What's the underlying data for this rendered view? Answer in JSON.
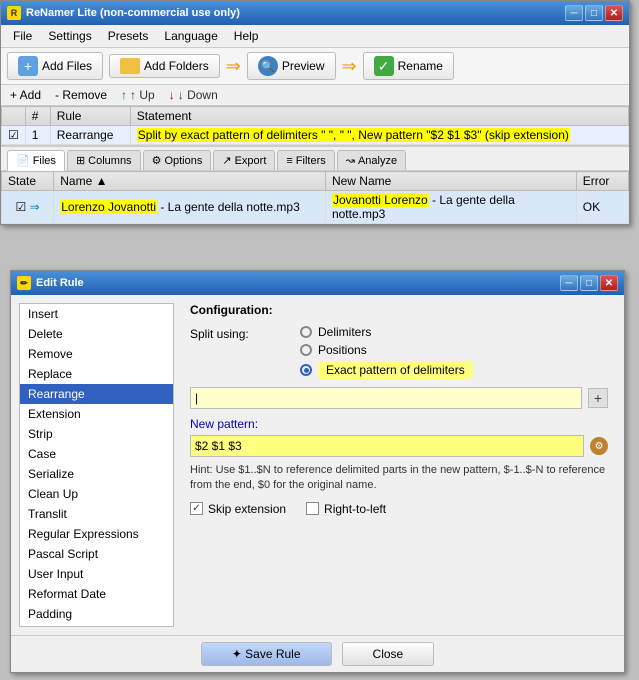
{
  "mainWindow": {
    "title": "ReNamer Lite (non-commercial use only)",
    "menu": {
      "items": [
        "File",
        "Settings",
        "Presets",
        "Language",
        "Help"
      ]
    },
    "toolbar": {
      "addFiles": "Add Files",
      "addFolders": "Add Folders",
      "preview": "Preview",
      "rename": "Rename"
    },
    "subToolbar": {
      "add": "+ Add",
      "remove": "- Remove",
      "up": "↑ Up",
      "down": "↓ Down"
    },
    "rulesTable": {
      "headers": [
        "#",
        "Rule",
        "Statement"
      ],
      "rows": [
        {
          "checked": true,
          "number": "1",
          "rule": "Rearrange",
          "statement": "Split by exact pattern of delimiters \" \", \" \", New pattern \"$2 $1 $3\" (skip extension)"
        }
      ]
    },
    "tabs": [
      "Files",
      "Columns",
      "Options",
      "Export",
      "Filters",
      "Analyze"
    ],
    "activeTab": "Files",
    "filesTable": {
      "headers": [
        "State",
        "Name ▲",
        "New Name",
        "Error"
      ],
      "rows": [
        {
          "checked": true,
          "arrow": "⇒",
          "name": "Lorenzo Jovanotti - La gente della notte.mp3",
          "nameHighlight": "Lorenzo Jovanotti",
          "newName": "Jovanotti Lorenzo - La gente della notte.mp3",
          "newNameHighlight": "Jovanotti Lorenzo",
          "error": "OK"
        }
      ]
    }
  },
  "editRuleWindow": {
    "title": "Edit Rule",
    "ruleList": [
      "Insert",
      "Delete",
      "Remove",
      "Replace",
      "Rearrange",
      "Extension",
      "Strip",
      "Case",
      "Serialize",
      "Clean Up",
      "Translit",
      "Regular Expressions",
      "Pascal Script",
      "User Input",
      "Reformat Date",
      "Padding"
    ],
    "selectedRule": "Rearrange",
    "config": {
      "title": "Configuration:",
      "splitUsing": "Split using:",
      "options": {
        "delimiters": "Delimiters",
        "positions": "Positions",
        "exactPattern": "Exact pattern of delimiters"
      },
      "selectedOption": "exactPattern",
      "delimiterInputValue": "|",
      "delimiterInputPlaceholder": "",
      "newPatternLabel": "New pattern:",
      "newPatternValue": "$2 $1 $3",
      "hintText": "Hint: Use $1..$N to reference delimited parts in the new pattern, $-1..$-N to reference from the end, $0 for the original name.",
      "skipExtension": "Skip extension",
      "skipExtensionChecked": true,
      "rightToLeft": "Right-to-left",
      "rightToLeftChecked": false
    },
    "footer": {
      "saveRule": "✦ Save Rule",
      "close": "Close"
    }
  }
}
